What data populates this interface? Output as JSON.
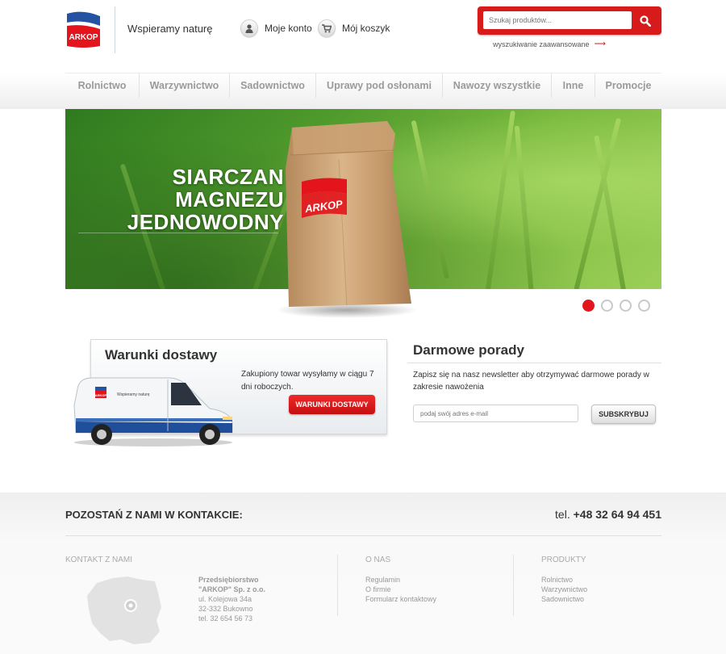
{
  "header": {
    "logo_text": "ARKOP",
    "tagline": "Wspieramy naturę",
    "account_label": "Moje konto",
    "cart_label": "Mój koszyk",
    "search_placeholder": "Szukaj produktów...",
    "advanced_search": "wyszukiwanie zaawansowane"
  },
  "nav": {
    "items": [
      "Rolnictwo",
      "Warzywnictwo",
      "Sadownictwo",
      "Uprawy pod osłonami",
      "Nawozy wszystkie",
      "Inne",
      "Promocje"
    ]
  },
  "hero": {
    "title_line1": "SIARCZAN MAGNEZU",
    "title_line2": "JEDNOWODNY",
    "bag_brand": "ARKOP",
    "slides_count": 4,
    "active_slide": 1
  },
  "delivery": {
    "title": "Warunki dostawy",
    "text": "Zakupiony towar wysyłamy w ciągu 7 dni roboczych.",
    "button": "WARUNKI DOSTAWY",
    "van_text": "Wspieramy naturę",
    "van_brand": "ARKOP"
  },
  "newsletter": {
    "title": "Darmowe porady",
    "text": "Zapisz się na nasz newsletter aby otrzymywać darmowe porady w zakresie nawożenia",
    "placeholder": "podaj swój adres e-mail",
    "button": "SUBSKRYBUJ"
  },
  "footer": {
    "stay_in_touch": "POZOSTAŃ Z NAMI W KONTAKCIE:",
    "phone_prefix": "tel.",
    "phone_number": "+48 32 64 94 451",
    "contact_head": "KONTAKT Z NAMI",
    "address": {
      "line1": "Przedsiębiorstwo",
      "line2": "\"ARKOP\" Sp. z o.o.",
      "line3": "ul. Kolejowa 34a",
      "line4": "32-332 Bukowno",
      "line5": "tel. 32 654 56 73"
    },
    "about_head": "O NAS",
    "about_links": [
      "Regulamin",
      "O firmie",
      "Formularz kontaktowy"
    ],
    "products_head": "PRODUKTY",
    "product_links": [
      "Rolnictwo",
      "Warzywnictwo",
      "Sadownictwo"
    ]
  },
  "colors": {
    "accent_red": "#e3141b",
    "brand_blue": "#1f4f9a",
    "nav_text": "#9a9a9a"
  }
}
